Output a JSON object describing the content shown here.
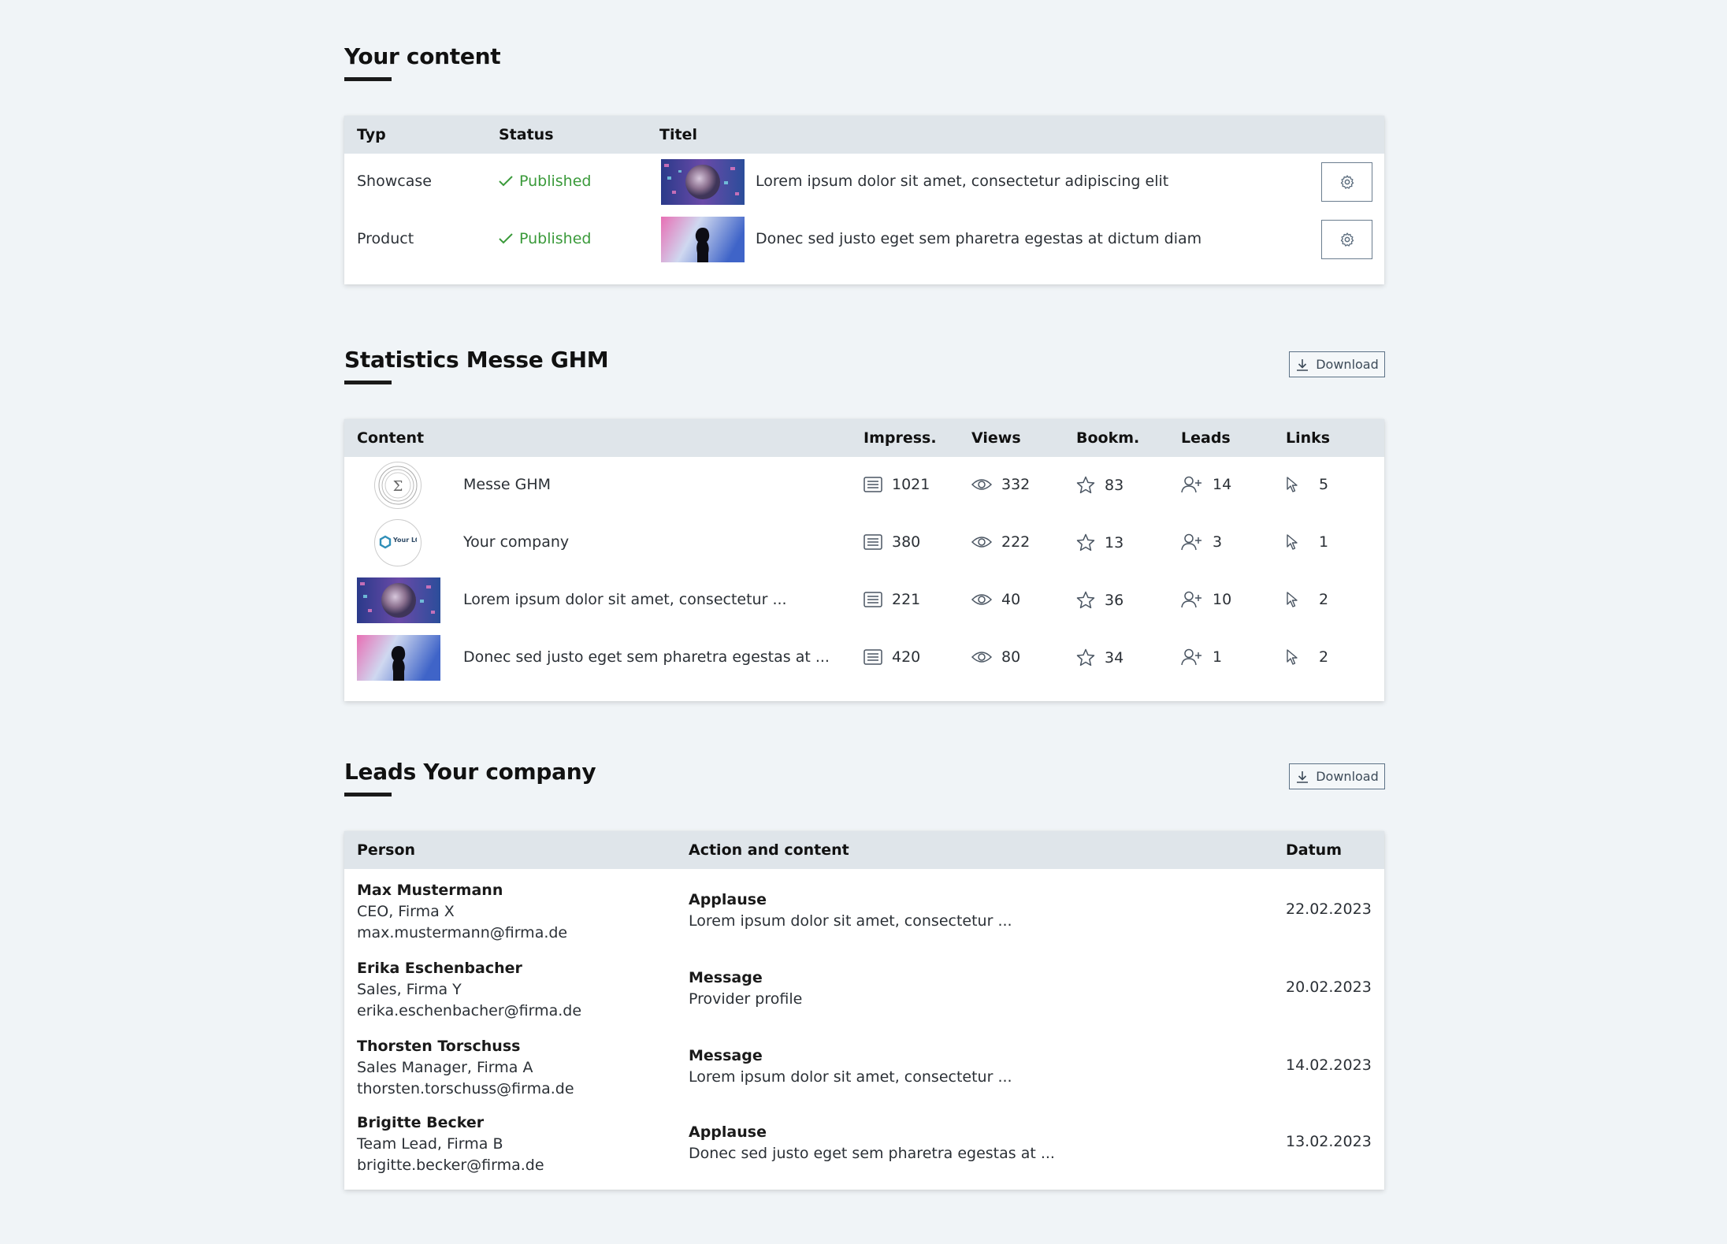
{
  "content_section": {
    "title": "Your content",
    "headers": {
      "typ": "Typ",
      "status": "Status",
      "titel": "Titel"
    },
    "rows": [
      {
        "typ": "Showcase",
        "status": "Published",
        "titel": "Lorem ipsum dolor sit amet, consectetur adipiscing elit",
        "thumb": "globe"
      },
      {
        "typ": "Product",
        "status": "Published",
        "titel": "Donec sed justo eget sem pharetra egestas at dictum diam",
        "thumb": "silhouette"
      }
    ]
  },
  "stats_section": {
    "title": "Statistics Messe GHM",
    "download_label": "Download",
    "headers": {
      "content": "Content",
      "impress": "Impress.",
      "views": "Views",
      "bookm": "Bookm.",
      "leads": "Leads",
      "links": "Links"
    },
    "rows": [
      {
        "thumb": "sigma-logo",
        "name": "Messe GHM",
        "impress": "1021",
        "views": "332",
        "bookm": "83",
        "leads": "14",
        "links": "5"
      },
      {
        "thumb": "your-logo",
        "logo_text": "Your LOGO",
        "name": "Your company",
        "impress": "380",
        "views": "222",
        "bookm": "13",
        "leads": "3",
        "links": "1"
      },
      {
        "thumb": "globe",
        "name": "Lorem ipsum dolor sit amet, consectetur ...",
        "impress": "221",
        "views": "40",
        "bookm": "36",
        "leads": "10",
        "links": "2"
      },
      {
        "thumb": "silhouette",
        "name": "Donec sed justo eget sem pharetra egestas at ...",
        "impress": "420",
        "views": "80",
        "bookm": "34",
        "leads": "1",
        "links": "2"
      }
    ]
  },
  "leads_section": {
    "title": "Leads Your company",
    "download_label": "Download",
    "headers": {
      "person": "Person",
      "action": "Action and content",
      "datum": "Datum"
    },
    "rows": [
      {
        "name": "Max Mustermann",
        "role": "CEO, Firma X",
        "email": "max.mustermann@firma.de",
        "action": "Applause",
        "content": "Lorem ipsum dolor sit amet, consectetur ...",
        "date": "22.02.2023"
      },
      {
        "name": "Erika Eschenbacher",
        "role": "Sales, Firma Y",
        "email": "erika.eschenbacher@firma.de",
        "action": "Message",
        "content": "Provider profile",
        "date": "20.02.2023"
      },
      {
        "name": "Thorsten Torschuss",
        "role": "Sales Manager, Firma A",
        "email": "thorsten.torschuss@firma.de",
        "action": "Message",
        "content": "Lorem ipsum dolor sit amet, consectetur ...",
        "date": "14.02.2023"
      },
      {
        "name": "Brigitte Becker",
        "role": "Team Lead, Firma B",
        "email": "brigitte.becker@firma.de",
        "action": "Applause",
        "content": "Donec sed justo eget sem pharetra egestas at ...",
        "date": "13.02.2023"
      }
    ]
  },
  "colors": {
    "published": "#3a9a3a",
    "header_bg": "#dfe5ea",
    "page_bg": "#f0f4f7"
  }
}
